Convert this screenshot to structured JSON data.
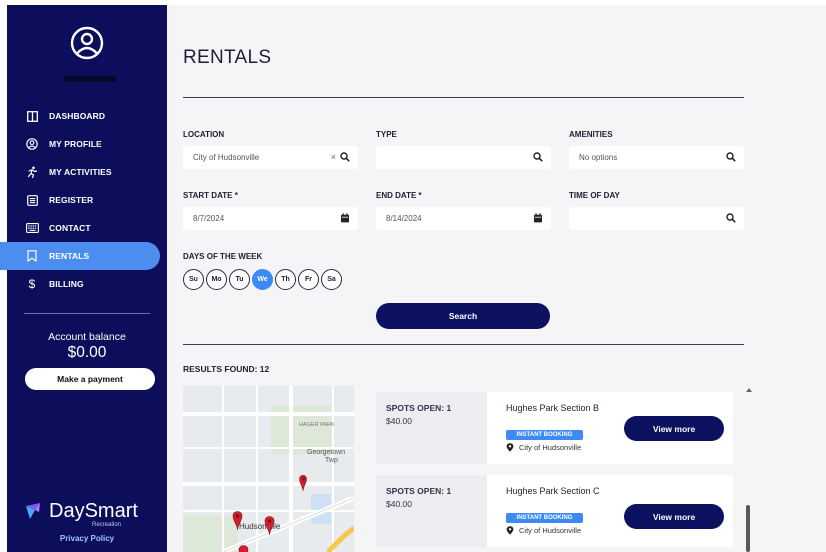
{
  "sidebar": {
    "nav": [
      {
        "label": "DASHBOARD",
        "icon": "layout-columns-icon"
      },
      {
        "label": "MY PROFILE",
        "icon": "user-circle-icon"
      },
      {
        "label": "MY ACTIVITIES",
        "icon": "running-person-icon"
      },
      {
        "label": "REGISTER",
        "icon": "list-box-icon"
      },
      {
        "label": "CONTACT",
        "icon": "keyboard-icon"
      },
      {
        "label": "RENTALS",
        "icon": "bookmark-icon",
        "active": true
      },
      {
        "label": "BILLING",
        "icon": "dollar-icon"
      }
    ],
    "balance_label": "Account balance",
    "balance_value": "$0.00",
    "payment_button": "Make a payment",
    "logo_text": "DaySmart",
    "logo_sub": "Recreation",
    "privacy_link": "Privacy Policy"
  },
  "main": {
    "title": "RENTALS",
    "filters": {
      "location": {
        "label": "LOCATION",
        "value": "City of Hudsonville",
        "clear": "×"
      },
      "type": {
        "label": "TYPE",
        "value": ""
      },
      "amenities": {
        "label": "AMENITIES",
        "placeholder": "No options"
      },
      "start_date": {
        "label": "START DATE *",
        "value": "8/7/2024"
      },
      "end_date": {
        "label": "END DATE *",
        "value": "8/14/2024"
      },
      "time_of_day": {
        "label": "TIME OF DAY",
        "value": ""
      }
    },
    "days_label": "DAYS OF THE WEEK",
    "days": [
      {
        "label": "Su",
        "selected": false
      },
      {
        "label": "Mo",
        "selected": false
      },
      {
        "label": "Tu",
        "selected": false
      },
      {
        "label": "We",
        "selected": true
      },
      {
        "label": "Th",
        "selected": false
      },
      {
        "label": "Fr",
        "selected": false
      },
      {
        "label": "Sa",
        "selected": false
      }
    ],
    "search_button": "Search",
    "results_label": "RESULTS FOUND: 12",
    "map": {
      "labels": [
        "HAGER PARK",
        "Georgetown",
        "Twp",
        "Hudsonville"
      ]
    },
    "results": [
      {
        "spots": "SPOTS OPEN: 1",
        "price": "$40.00",
        "name": "Hughes Park Section B",
        "badge": "INSTANT BOOKING",
        "location": "City of Hudsonville",
        "button": "View more"
      },
      {
        "spots": "SPOTS OPEN: 1",
        "price": "$40.00",
        "name": "Hughes Park Section C",
        "badge": "INSTANT BOOKING",
        "location": "City of Hudsonville",
        "button": "View more"
      }
    ]
  },
  "colors": {
    "sidebar_bg": "#0c0e5c",
    "accent": "#3d8af7",
    "primary_button": "#0c1160",
    "main_bg": "#f5f5f8"
  }
}
